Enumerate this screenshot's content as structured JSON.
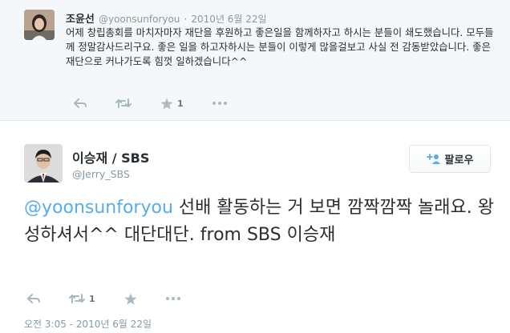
{
  "parent_tweet": {
    "author_name": "조윤선",
    "handle": "@yoonsunforyou",
    "separator": "·",
    "timestamp": "2010년 6월 22일",
    "text": "어제 창립총회를 마치자마자 재단을 후원하고 좋은일을 함께하자고 하시는 분들이 쇄도했습니다. 모두들께 정말감사드리구요. 좋은 일을 하고자하시는 분들이 이렇게 많을걸보고 사실 전 감동받았습니다. 좋은재단으로 커나가도록 힘껏 일하겠습니다^^",
    "favorite_count": "1",
    "icons": [
      "reply-icon",
      "retweet-icon",
      "favorite-star-icon",
      "more-icon"
    ]
  },
  "main_tweet": {
    "author_name": "이승재 / SBS",
    "handle": "@Jerry_SBS",
    "follow_label": "팔로우",
    "mention": "@yoonsunforyou",
    "text": " 선배 활동하는 거 보면 깜짝깜짝 놀래요. 왕성하셔서^^ 대단대단. from SBS 이승재",
    "retweet_count": "1",
    "timestamp": "오전 3:05 - 2010년 6월 22일",
    "icons": [
      "reply-icon",
      "retweet-icon",
      "favorite-star-icon",
      "more-icon",
      "follow-person-plus-icon"
    ]
  },
  "colors": {
    "link_blue": "#55acee",
    "muted_gray": "#8899a6",
    "action_gray": "#aab8c2",
    "text": "#292f33",
    "parent_background": "#f5f8fa"
  }
}
